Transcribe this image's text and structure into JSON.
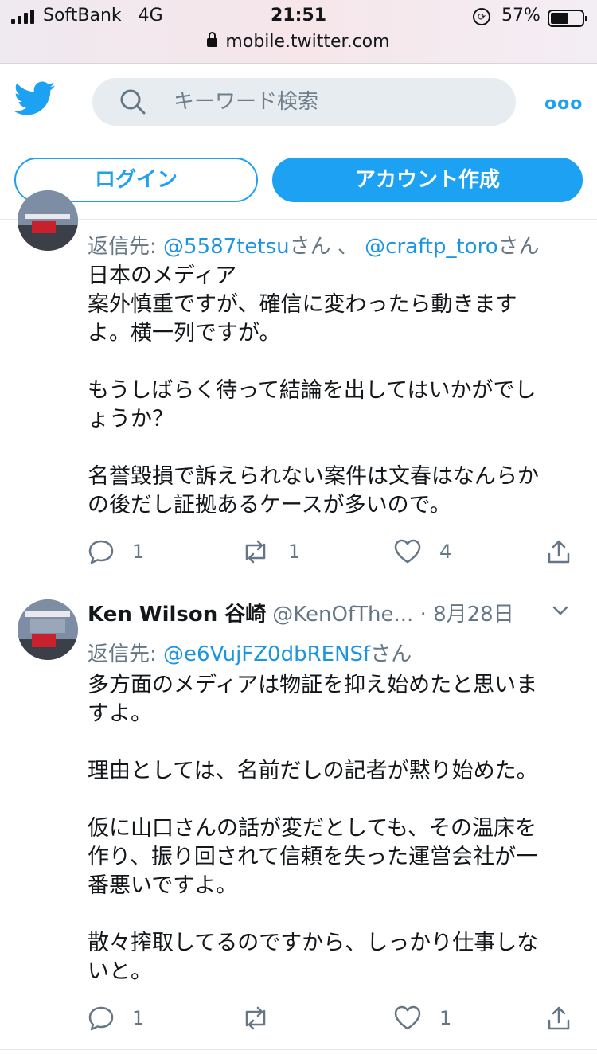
{
  "status_bar": {
    "carrier": "SoftBank",
    "network": "4G",
    "time": "21:51",
    "battery_percent": "57%",
    "battery_level": 0.57,
    "url": "mobile.twitter.com"
  },
  "header": {
    "search_placeholder": "キーワード検索",
    "login_label": "ログイン",
    "signup_label": "アカウント作成",
    "accent_color": "#1da1f2"
  },
  "tweets": [
    {
      "reply_label": "返信先: ",
      "reply_mentions": [
        "@5587tetsu",
        "@craftp_toro"
      ],
      "reply_san": "さん",
      "reply_separator": " 、 ",
      "text": "日本のメディア\n案外慎重ですが、確信に変わったら動きます\nよ。横一列ですが。\n\nもうしばらく待って結論を出してはいかがでし\nょうか？\n\n名誉毀損で訴えられない案件は文春はなんらか\nの後だし証拠あるケースが多いので。",
      "reply_count": "1",
      "retweet_count": "1",
      "like_count": "4"
    },
    {
      "author_name": "Ken Wilson 谷崎",
      "author_handle": "@KenOfThe...",
      "date": "· 8月28日",
      "reply_label": "返信先: ",
      "reply_mentions": [
        "@e6VujFZ0dbRENSf"
      ],
      "reply_san": "さん",
      "text": "多方面のメディアは物証を抑え始めたと思いま\nすよ。\n\n理由としては、名前だしの記者が黙り始めた。\n\n仮に山口さんの話が変だとしても、その温床を\n作り、振り回されて信頼を失った運営会社が一\n番悪いですよ。\n\n散々搾取してるのですから、しっかり仕事しな\nいと。",
      "reply_count": "1",
      "retweet_count": "",
      "like_count": "1"
    }
  ]
}
